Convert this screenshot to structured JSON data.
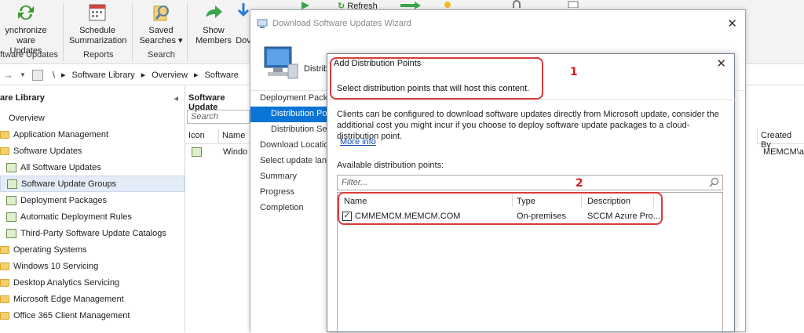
{
  "ribbon": {
    "buttons": [
      {
        "label": "Synchronize\nware Updates",
        "icon": "sync-icon"
      },
      {
        "label": "Schedule\nSummarization",
        "icon": "calendar-icon"
      },
      {
        "label": "Saved\nSearches ▾",
        "icon": "saved-search-icon"
      },
      {
        "label": "Show\nMembers",
        "icon": "green-arrow-icon"
      },
      {
        "label": "Dov",
        "icon": "download-icon"
      }
    ],
    "refresh": "Refresh",
    "groups": [
      "ftware Updates",
      "Reports",
      "Search"
    ]
  },
  "address": {
    "root": "\\",
    "crumbs": [
      "Software Library",
      "Overview",
      "Software"
    ]
  },
  "nav": {
    "title": "are Library",
    "items": [
      {
        "label": "Overview",
        "kind": "overview",
        "indent": 0
      },
      {
        "label": "Application Management",
        "kind": "folder",
        "indent": 1
      },
      {
        "label": "Software Updates",
        "kind": "folder",
        "indent": 1
      },
      {
        "label": "All Software Updates",
        "kind": "item",
        "indent": 2
      },
      {
        "label": "Software Update Groups",
        "kind": "item",
        "indent": 2,
        "selected": true
      },
      {
        "label": "Deployment Packages",
        "kind": "item",
        "indent": 2
      },
      {
        "label": "Automatic Deployment Rules",
        "kind": "item",
        "indent": 2
      },
      {
        "label": "Third-Party Software Update Catalogs",
        "kind": "item",
        "indent": 2
      },
      {
        "label": "Operating Systems",
        "kind": "folder",
        "indent": 1
      },
      {
        "label": "Windows 10 Servicing",
        "kind": "folder",
        "indent": 1
      },
      {
        "label": "Desktop Analytics Servicing",
        "kind": "folder",
        "indent": 1
      },
      {
        "label": "Microsoft Edge Management",
        "kind": "folder",
        "indent": 1
      },
      {
        "label": "Office 365 Client Management",
        "kind": "folder",
        "indent": 1
      }
    ]
  },
  "mid": {
    "title": "Software Update",
    "search_placeholder": "Search",
    "col_icon": "Icon",
    "col_name": "Name",
    "row_name": "Windo"
  },
  "right": {
    "col_created": "Created By",
    "row_created": "MEMCM\\a"
  },
  "wizard": {
    "title": "Download Software Updates Wizard",
    "banner_text": "Distrib",
    "steps": [
      {
        "label": "Deployment Packa",
        "type": "header"
      },
      {
        "label": "Distribution Poi",
        "type": "active"
      },
      {
        "label": "Distribution Set",
        "type": "sub"
      },
      {
        "label": "Download Locatio",
        "type": "normal"
      },
      {
        "label": "Select update lang",
        "type": "normal"
      },
      {
        "label": "Summary",
        "type": "normal"
      },
      {
        "label": "Progress",
        "type": "normal"
      },
      {
        "label": "Completion",
        "type": "normal"
      }
    ]
  },
  "dialog": {
    "title": "Add Distribution Points",
    "subtitle": "Select distribution points that will host this content.",
    "description": "Clients can be configured to download software updates directly from Microsoft update, consider the additional cost you might incur if you choose to deploy software update packages to a cloud-distribution point.",
    "more_info": "More info",
    "available_label": "Available distribution points:",
    "filter_placeholder": "Filter...",
    "columns": [
      "Name",
      "Type",
      "Description"
    ],
    "rows": [
      {
        "checked": true,
        "name": "CMMEMCM.MEMCM.COM",
        "type": "On-premises",
        "description": "SCCM Azure Pro..."
      }
    ]
  },
  "annotations": [
    "1",
    "2"
  ],
  "colors": {
    "accent": "#0a74d7",
    "highlight": "#d93b3b"
  }
}
